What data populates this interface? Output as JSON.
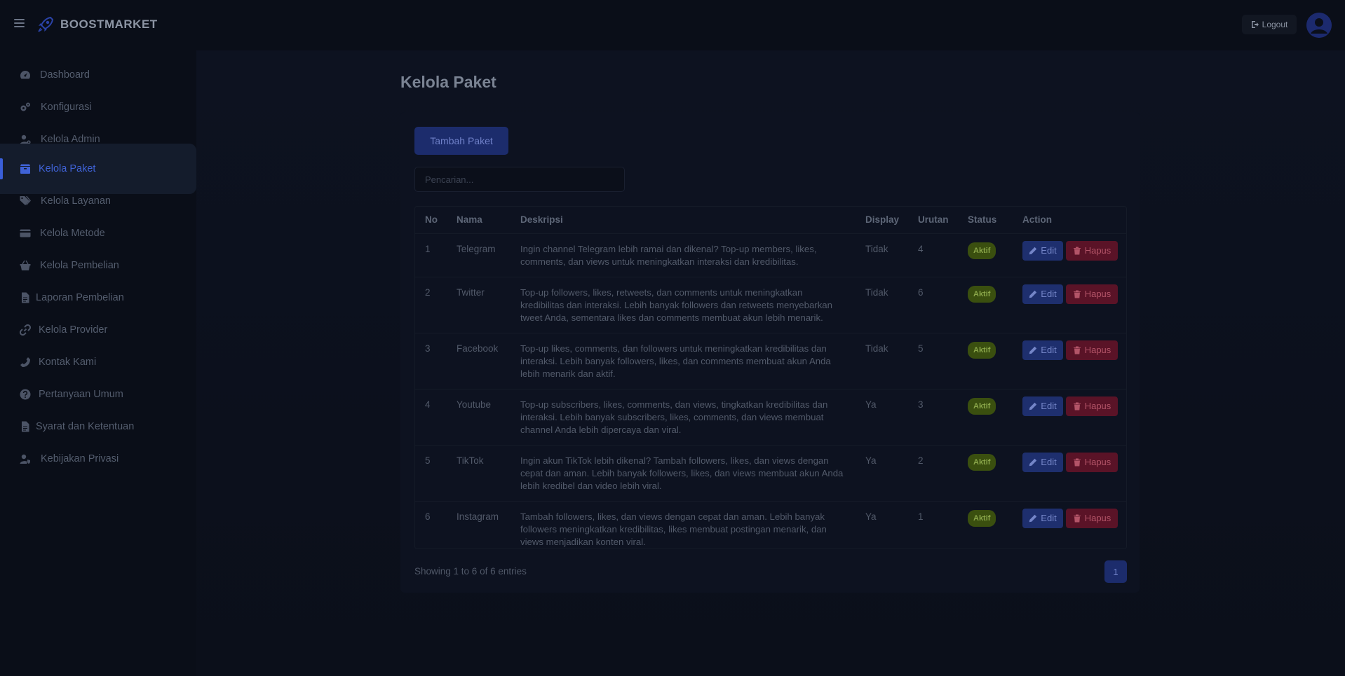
{
  "app": {
    "brand": "BOOSTMARKET"
  },
  "header": {
    "logout_label": "Logout"
  },
  "sidebar": {
    "items": [
      {
        "label": "Dashboard",
        "icon": "gauge-icon"
      },
      {
        "label": "Konfigurasi",
        "icon": "gears-icon"
      },
      {
        "label": "Kelola Admin",
        "icon": "user-gear-icon"
      },
      {
        "label": "Kelola Paket",
        "icon": "box-icon",
        "active": true
      },
      {
        "label": "Kelola Layanan",
        "icon": "tags-icon"
      },
      {
        "label": "Kelola Metode",
        "icon": "credit-card-icon"
      },
      {
        "label": "Kelola Pembelian",
        "icon": "basket-icon"
      },
      {
        "label": "Laporan Pembelian",
        "icon": "file-icon"
      },
      {
        "label": "Kelola Provider",
        "icon": "link-icon"
      },
      {
        "label": "Kontak Kami",
        "icon": "phone-icon"
      },
      {
        "label": "Pertanyaan Umum",
        "icon": "question-icon"
      },
      {
        "label": "Syarat dan Ketentuan",
        "icon": "file-icon"
      },
      {
        "label": "Kebijakan Privasi",
        "icon": "user-shield-icon"
      }
    ]
  },
  "main": {
    "title": "Kelola Paket",
    "add_button": "Tambah Paket",
    "search_placeholder": "Pencarian...",
    "columns": [
      "No",
      "Nama",
      "Deskripsi",
      "Display",
      "Urutan",
      "Status",
      "Action"
    ],
    "rows": [
      {
        "no": "1",
        "nama": "Telegram",
        "deskripsi": "Ingin channel Telegram lebih ramai dan dikenal? Top-up members, likes, comments, dan views untuk meningkatkan interaksi dan kredibilitas.",
        "display": "Tidak",
        "urutan": "4",
        "status": "Aktif"
      },
      {
        "no": "2",
        "nama": "Twitter",
        "deskripsi": "Top-up followers, likes, retweets, dan comments untuk meningkatkan kredibilitas dan interaksi. Lebih banyak followers dan retweets menyebarkan tweet Anda, sementara likes dan comments membuat akun lebih menarik.",
        "display": "Tidak",
        "urutan": "6",
        "status": "Aktif"
      },
      {
        "no": "3",
        "nama": "Facebook",
        "deskripsi": "Top-up likes, comments, dan followers untuk meningkatkan kredibilitas dan interaksi. Lebih banyak followers, likes, dan comments membuat akun Anda lebih menarik dan aktif.",
        "display": "Tidak",
        "urutan": "5",
        "status": "Aktif"
      },
      {
        "no": "4",
        "nama": "Youtube",
        "deskripsi": "Top-up subscribers, likes, comments, dan views, tingkatkan kredibilitas dan interaksi. Lebih banyak subscribers, likes, comments, dan views membuat channel Anda lebih dipercaya dan viral.",
        "display": "Ya",
        "urutan": "3",
        "status": "Aktif"
      },
      {
        "no": "5",
        "nama": "TikTok",
        "deskripsi": "Ingin akun TikTok lebih dikenal? Tambah followers, likes, dan views dengan cepat dan aman. Lebih banyak followers, likes, dan views membuat akun Anda lebih kredibel dan video lebih viral.",
        "display": "Ya",
        "urutan": "2",
        "status": "Aktif"
      },
      {
        "no": "6",
        "nama": "Instagram",
        "deskripsi": "Tambah followers, likes, dan views dengan cepat dan aman. Lebih banyak followers meningkatkan kredibilitas, likes membuat postingan menarik, dan views menjadikan konten viral.",
        "display": "Ya",
        "urutan": "1",
        "status": "Aktif"
      }
    ],
    "edit_label": "Edit",
    "delete_label": "Hapus",
    "showing_text": "Showing 1 to 6 of 6 entries",
    "current_page": "1"
  },
  "colors": {
    "accent": "#3f62d6",
    "danger": "#5a1327",
    "success": "#3a4f0f"
  }
}
